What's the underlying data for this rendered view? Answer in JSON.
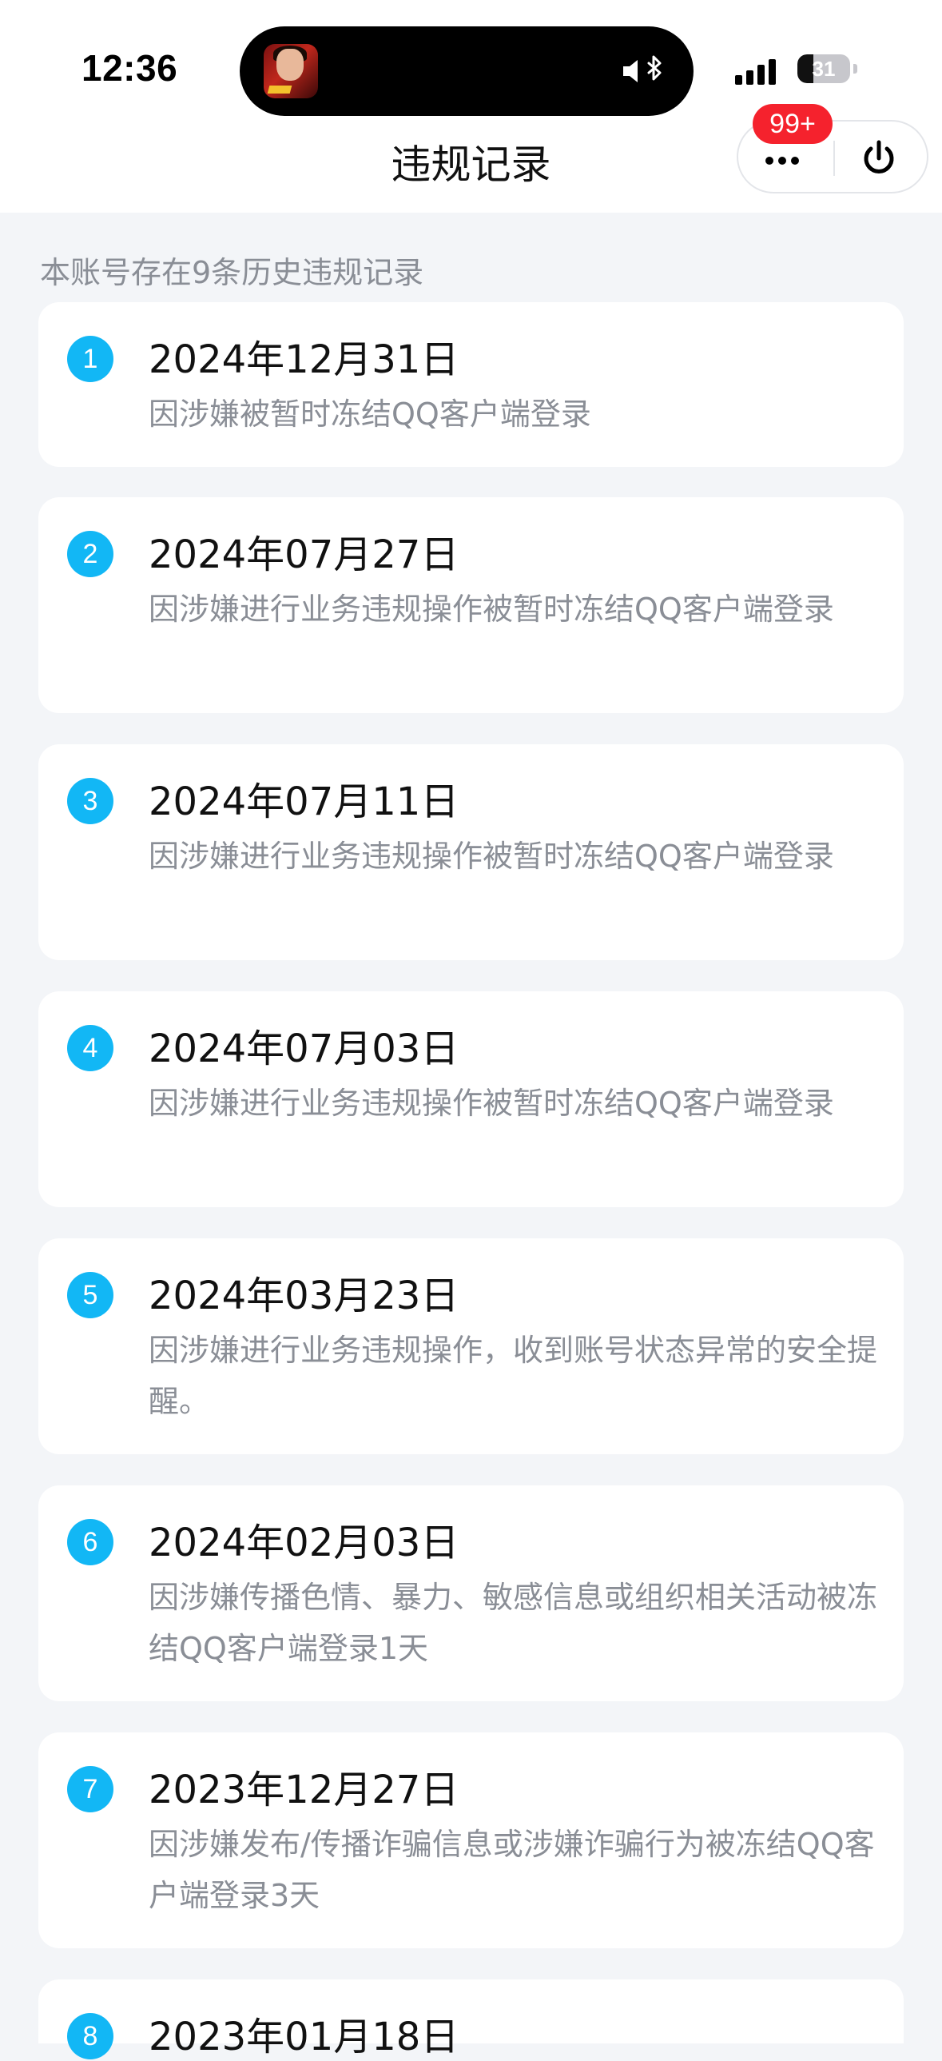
{
  "status_bar": {
    "time": "12:36",
    "battery_level": "31"
  },
  "header": {
    "title": "违规记录",
    "badge": "99+"
  },
  "summary": "本账号存在9条历史违规记录",
  "records": [
    {
      "num": "1",
      "date": "2024年12月31日",
      "desc": "因涉嫌被暂时冻结QQ客户端登录"
    },
    {
      "num": "2",
      "date": "2024年07月27日",
      "desc": "因涉嫌进行业务违规操作被暂时冻结QQ客户端登录"
    },
    {
      "num": "3",
      "date": "2024年07月11日",
      "desc": "因涉嫌进行业务违规操作被暂时冻结QQ客户端登录"
    },
    {
      "num": "4",
      "date": "2024年07月03日",
      "desc": "因涉嫌进行业务违规操作被暂时冻结QQ客户端登录"
    },
    {
      "num": "5",
      "date": "2024年03月23日",
      "desc": "因涉嫌进行业务违规操作，收到账号状态异常的安全提醒。"
    },
    {
      "num": "6",
      "date": "2024年02月03日",
      "desc": "因涉嫌传播色情、暴力、敏感信息或组织相关活动被冻结QQ客户端登录1天"
    },
    {
      "num": "7",
      "date": "2023年12月27日",
      "desc": "因涉嫌发布/传播诈骗信息或涉嫌诈骗行为被冻结QQ客户端登录3天"
    },
    {
      "num": "8",
      "date": "2023年01月18日",
      "desc": ""
    }
  ],
  "colors": {
    "accent": "#12b7f5",
    "badge": "#f5222d",
    "background": "#f3f5f8"
  }
}
